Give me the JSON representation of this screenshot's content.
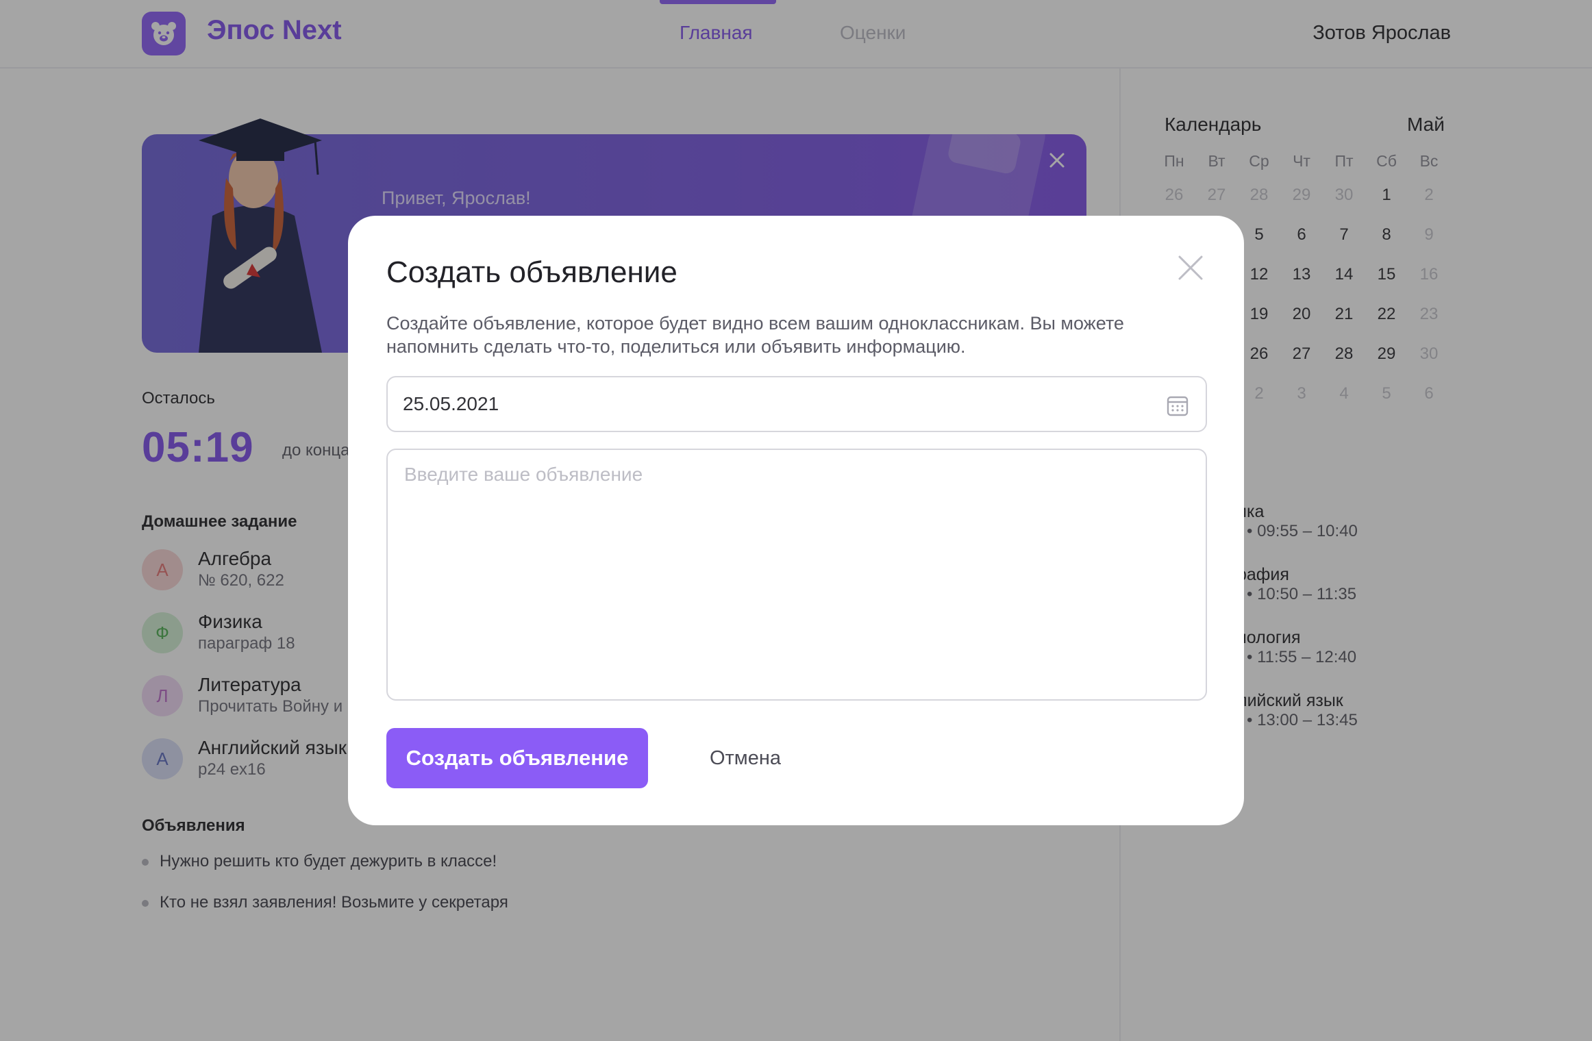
{
  "header": {
    "brand": "Эпос Next",
    "nav": {
      "home": "Главная",
      "grades": "Оценки"
    },
    "user_name": "Зотов Ярослав"
  },
  "banner": {
    "greeting": "Привет, Ярослав!"
  },
  "timer": {
    "label": "Осталось",
    "value": "05:19",
    "note": "до конца"
  },
  "homework": {
    "title": "Домашнее задание",
    "items": [
      {
        "initial": "А",
        "subject": "Алгебра",
        "task": "№ 620, 622",
        "color": "#e57373"
      },
      {
        "initial": "Ф",
        "subject": "Физика",
        "task": "параграф 18",
        "color": "#66bb6a"
      },
      {
        "initial": "Л",
        "subject": "Литература",
        "task": "Прочитать Войну и",
        "color": "#ba68c8"
      },
      {
        "initial": "А",
        "subject": "Английский язык",
        "task": "p24 ex16",
        "color": "#7986cb"
      }
    ]
  },
  "announcements": {
    "title": "Объявления",
    "items": [
      "Нужно решить кто будет дежурить в классе!",
      "Кто не взял заявления! Возьмите у секретаря"
    ]
  },
  "calendar": {
    "title": "Календарь",
    "month": "Май",
    "weekdays": [
      "Пн",
      "Вт",
      "Ср",
      "Чт",
      "Пт",
      "Сб",
      "Вс"
    ],
    "weeks": [
      [
        "26",
        "27",
        "28",
        "29",
        "30",
        "1",
        "2"
      ],
      [
        "",
        "",
        "5",
        "6",
        "7",
        "8",
        "9"
      ],
      [
        "",
        "",
        "12",
        "13",
        "14",
        "15",
        "16"
      ],
      [
        "",
        "",
        "19",
        "20",
        "21",
        "22",
        "23"
      ],
      [
        "",
        "",
        "26",
        "27",
        "28",
        "29",
        "30"
      ],
      [
        "",
        "",
        "2",
        "3",
        "4",
        "5",
        "6"
      ]
    ]
  },
  "schedule": {
    "lessons": [
      {
        "name": "ика",
        "time": "• 09:55 – 10:40"
      },
      {
        "name": "рафия",
        "time": "• 10:50 – 11:35"
      },
      {
        "name": "нология",
        "time": "• 11:55 – 12:40"
      },
      {
        "name": "лийский язык",
        "time": "• 13:00 – 13:45"
      }
    ]
  },
  "modal": {
    "title": "Создать объявление",
    "description": "Создайте объявление, которое будет видно всем вашим одноклассникам. Вы можете напомнить сделать что-то, поделиться или объявить информацию.",
    "date_value": "25.05.2021",
    "textarea_placeholder": "Введите ваше объявление",
    "submit_label": "Создать объявление",
    "cancel_label": "Отмена"
  },
  "colors": {
    "accent": "#8b5cf6",
    "overlay": "rgba(40,40,40,0.42)"
  }
}
